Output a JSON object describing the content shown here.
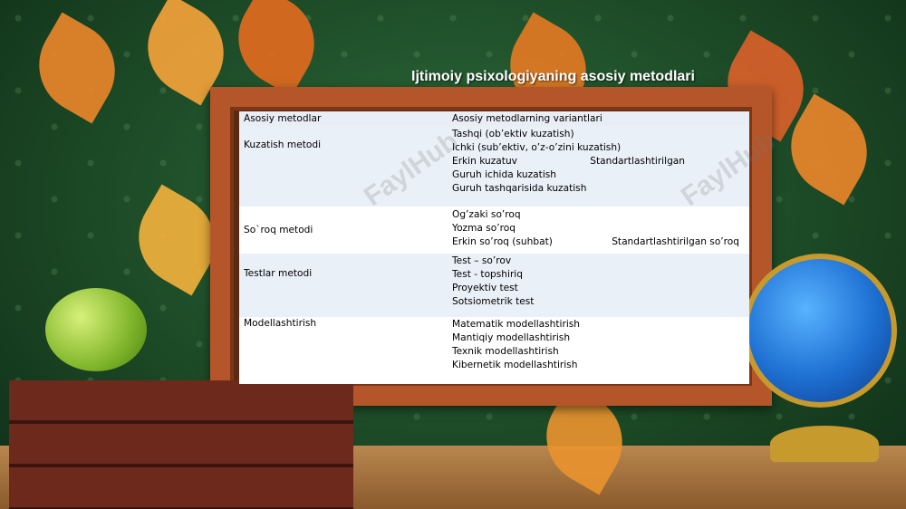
{
  "slide": {
    "title": "Ijtimoiy psixologiyaning asosiy metodlari"
  },
  "table": {
    "headers": [
      "Asosiy  metodlar",
      "Asosiy metodlarning variantlari"
    ],
    "rows": [
      {
        "method": "Kuzatish metodi",
        "variants": [
          "Tashqi (ob’ektiv kuzatish)",
          "Ichki  (sub’ektiv, o’z-o’zini kuzatish)",
          "Erkin kuzatuv",
          "Guruh ichida kuzatish",
          "Guruh tashqarisida kuzatish"
        ],
        "variant_right": "Standartlashtirilgan"
      },
      {
        "method": "So`roq metodi",
        "variants": [
          "Og’zaki so’roq",
          "Yozma so’roq",
          "Erkin so’roq (suhbat)"
        ],
        "variant_right": "Standartlashtirilgan so’roq"
      },
      {
        "method": "Testlar metodi",
        "variants": [
          "Test – so’rov",
          "Test - topshiriq",
          "Proyektiv test",
          "Sotsiometrik test"
        ]
      },
      {
        "method": "Modellashtirish",
        "variants": [
          "Matematik modellashtirish",
          "Mantiqiy modellashtirish",
          "Texnik modellashtirish",
          "Kibernetik modellashtirish"
        ]
      }
    ]
  },
  "watermark": "FaylHub",
  "colors": {
    "frame": "#b4562a",
    "background_green": "#1c4a26",
    "title_text": "#ffffff"
  }
}
